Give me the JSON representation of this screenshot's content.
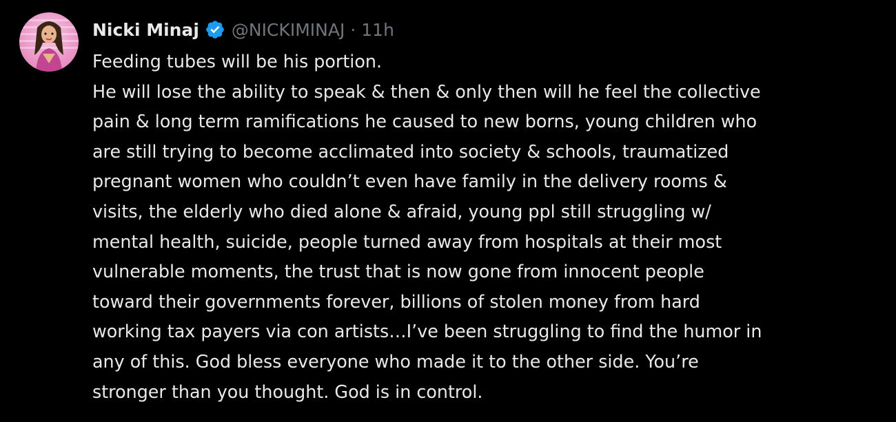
{
  "tweet": {
    "author": {
      "display_name": "Nicki Minaj",
      "handle": "@NICKIMINAJ",
      "verified_icon": "verified-badge-icon",
      "avatar_icon": "profile-avatar"
    },
    "separator": "·",
    "timestamp": "11h",
    "lines": [
      "Feeding tubes will be his portion.",
      "He will lose the ability to speak & then & only then will he feel the collective",
      "pain & long term ramifications he caused to new borns, young children who",
      "are still trying to become acclimated into society & schools, traumatized",
      "pregnant women who couldn’t even have family in the delivery rooms &",
      "visits, the elderly who died alone & afraid, young ppl still struggling w/",
      "mental health, suicide, people turned away from hospitals at their most",
      "vulnerable moments, the trust that is now gone from innocent people",
      "toward their governments forever, billions of stolen money from hard",
      "working tax payers via con artists…I’ve been struggling to find the humor in",
      "any of this. God bless everyone who made it to the other side. You’re",
      "stronger than you thought. God is in control."
    ]
  },
  "colors": {
    "background": "#000000",
    "primary_text": "#e7e9ea",
    "secondary_text": "#71767b",
    "verified_blue": "#1d9bf0"
  }
}
